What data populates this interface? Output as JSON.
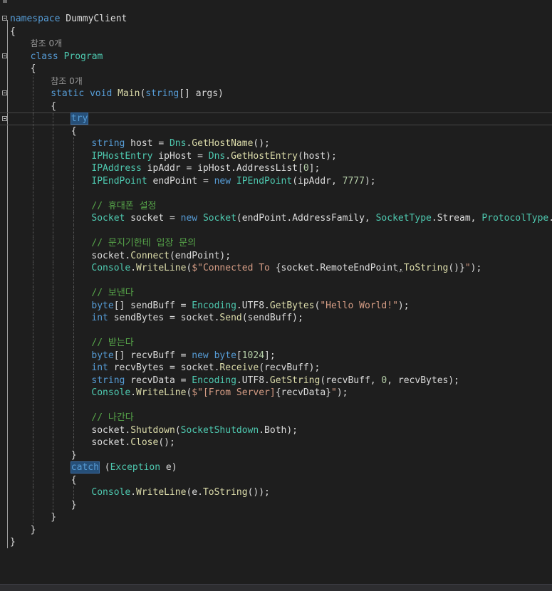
{
  "editor": {
    "language": "C#",
    "colors": {
      "background": "#1e1e1e",
      "keyword": "#569cd6",
      "type": "#4ec9b0",
      "method": "#dcdcaa",
      "string": "#d69d85",
      "comment": "#57a64a",
      "number": "#b5cea8",
      "text": "#dcdcdc"
    },
    "lines": [
      {
        "indent": 0,
        "fold": true,
        "tokens": [
          [
            "kw",
            "namespace"
          ],
          [
            "id",
            " DummyClient"
          ]
        ]
      },
      {
        "indent": 0,
        "tokens": [
          [
            "id",
            "{"
          ]
        ]
      },
      {
        "indent": 1,
        "tokens": [
          [
            "lens",
            "참조 0개"
          ]
        ]
      },
      {
        "indent": 1,
        "fold": true,
        "tokens": [
          [
            "kw",
            "class"
          ],
          [
            "id",
            " "
          ],
          [
            "ty",
            "Program"
          ]
        ]
      },
      {
        "indent": 1,
        "tokens": [
          [
            "id",
            "{"
          ]
        ]
      },
      {
        "indent": 2,
        "tokens": [
          [
            "lens",
            "참조 0개"
          ]
        ]
      },
      {
        "indent": 2,
        "fold": true,
        "tokens": [
          [
            "kw",
            "static"
          ],
          [
            "id",
            " "
          ],
          [
            "kw",
            "void"
          ],
          [
            "id",
            " "
          ],
          [
            "fn",
            "Main"
          ],
          [
            "id",
            "("
          ],
          [
            "kw",
            "string"
          ],
          [
            "id",
            "[] args)"
          ]
        ]
      },
      {
        "indent": 2,
        "tokens": [
          [
            "id",
            "{"
          ]
        ]
      },
      {
        "indent": 3,
        "fold": true,
        "current": true,
        "tokens": [
          [
            "kw hl",
            "try"
          ]
        ]
      },
      {
        "indent": 3,
        "tokens": [
          [
            "id",
            "{"
          ]
        ]
      },
      {
        "indent": 4,
        "tokens": [
          [
            "kw",
            "string"
          ],
          [
            "id",
            " host = "
          ],
          [
            "ty",
            "Dns"
          ],
          [
            "id",
            "."
          ],
          [
            "fn",
            "GetHostName"
          ],
          [
            "id",
            "();"
          ]
        ]
      },
      {
        "indent": 4,
        "tokens": [
          [
            "ty",
            "IPHostEntry"
          ],
          [
            "id",
            " ipHost = "
          ],
          [
            "ty",
            "Dns"
          ],
          [
            "id",
            "."
          ],
          [
            "fn",
            "GetHostEntry"
          ],
          [
            "id",
            "(host);"
          ]
        ]
      },
      {
        "indent": 4,
        "tokens": [
          [
            "ty",
            "IPAddress"
          ],
          [
            "id",
            " ipAddr = ipHost.AddressList["
          ],
          [
            "num",
            "0"
          ],
          [
            "id",
            "];"
          ]
        ]
      },
      {
        "indent": 4,
        "tokens": [
          [
            "ty",
            "IPEndPoint"
          ],
          [
            "id",
            " endPoint = "
          ],
          [
            "kw",
            "new"
          ],
          [
            "id",
            " "
          ],
          [
            "ty",
            "IPEndPoint"
          ],
          [
            "id",
            "(ipAddr, "
          ],
          [
            "num",
            "7777"
          ],
          [
            "id",
            ");"
          ]
        ]
      },
      {
        "indent": 4,
        "tokens": []
      },
      {
        "indent": 4,
        "tokens": [
          [
            "cm",
            "// 휴대폰 설정"
          ]
        ]
      },
      {
        "indent": 4,
        "tokens": [
          [
            "ty",
            "Socket"
          ],
          [
            "id",
            " socket = "
          ],
          [
            "kw",
            "new"
          ],
          [
            "id",
            " "
          ],
          [
            "ty",
            "Socket"
          ],
          [
            "id",
            "(endPoint.AddressFamily, "
          ],
          [
            "ty",
            "SocketType"
          ],
          [
            "id",
            ".Stream, "
          ],
          [
            "ty",
            "ProtocolType"
          ],
          [
            "id",
            ".Tcp);"
          ]
        ]
      },
      {
        "indent": 4,
        "tokens": []
      },
      {
        "indent": 4,
        "tokens": [
          [
            "cm",
            "// 문지기한테 입장 문의"
          ]
        ]
      },
      {
        "indent": 4,
        "tokens": [
          [
            "id",
            "socket."
          ],
          [
            "fn",
            "Connect"
          ],
          [
            "id",
            "(endPoint);"
          ]
        ]
      },
      {
        "indent": 4,
        "tokens": [
          [
            "ty",
            "Console"
          ],
          [
            "id",
            "."
          ],
          [
            "fn",
            "WriteLine"
          ],
          [
            "id",
            "("
          ],
          [
            "str",
            "$\"Connected To "
          ],
          [
            "id",
            "{socket.RemoteEndPoint"
          ],
          [
            "id sq",
            "."
          ],
          [
            "fn",
            "ToString"
          ],
          [
            "id",
            "()}"
          ],
          [
            "str",
            "\""
          ],
          [
            "id",
            ");"
          ]
        ]
      },
      {
        "indent": 4,
        "tokens": []
      },
      {
        "indent": 4,
        "tokens": [
          [
            "cm",
            "// 보낸다"
          ]
        ]
      },
      {
        "indent": 4,
        "tokens": [
          [
            "kw",
            "byte"
          ],
          [
            "id",
            "[] sendBuff = "
          ],
          [
            "ty",
            "Encoding"
          ],
          [
            "id",
            ".UTF8."
          ],
          [
            "fn",
            "GetBytes"
          ],
          [
            "id",
            "("
          ],
          [
            "str",
            "\"Hello World!\""
          ],
          [
            "id",
            ");"
          ]
        ]
      },
      {
        "indent": 4,
        "tokens": [
          [
            "kw",
            "int"
          ],
          [
            "id",
            " sendBytes = socket."
          ],
          [
            "fn",
            "Send"
          ],
          [
            "id",
            "(sendBuff);"
          ]
        ]
      },
      {
        "indent": 4,
        "tokens": []
      },
      {
        "indent": 4,
        "tokens": [
          [
            "cm",
            "// 받는다"
          ]
        ]
      },
      {
        "indent": 4,
        "tokens": [
          [
            "kw",
            "byte"
          ],
          [
            "id",
            "[] recvBuff = "
          ],
          [
            "kw",
            "new"
          ],
          [
            "id",
            " "
          ],
          [
            "kw",
            "byte"
          ],
          [
            "id",
            "["
          ],
          [
            "num",
            "1024"
          ],
          [
            "id",
            "];"
          ]
        ]
      },
      {
        "indent": 4,
        "tokens": [
          [
            "kw",
            "int"
          ],
          [
            "id",
            " recvBytes = socket."
          ],
          [
            "fn",
            "Receive"
          ],
          [
            "id",
            "(recvBuff);"
          ]
        ]
      },
      {
        "indent": 4,
        "tokens": [
          [
            "kw",
            "string"
          ],
          [
            "id",
            " recvData = "
          ],
          [
            "ty",
            "Encoding"
          ],
          [
            "id",
            ".UTF8."
          ],
          [
            "fn",
            "GetString"
          ],
          [
            "id",
            "(recvBuff, "
          ],
          [
            "num",
            "0"
          ],
          [
            "id",
            ", recvBytes);"
          ]
        ]
      },
      {
        "indent": 4,
        "tokens": [
          [
            "ty",
            "Console"
          ],
          [
            "id",
            "."
          ],
          [
            "fn",
            "WriteLine"
          ],
          [
            "id",
            "("
          ],
          [
            "str",
            "$\"[From Server]"
          ],
          [
            "id",
            "{recvData}"
          ],
          [
            "str",
            "\""
          ],
          [
            "id",
            ");"
          ]
        ]
      },
      {
        "indent": 4,
        "tokens": []
      },
      {
        "indent": 4,
        "tokens": [
          [
            "cm",
            "// 나간다"
          ]
        ]
      },
      {
        "indent": 4,
        "tokens": [
          [
            "id",
            "socket."
          ],
          [
            "fn",
            "Shutdown"
          ],
          [
            "id",
            "("
          ],
          [
            "ty",
            "SocketShutdown"
          ],
          [
            "id",
            ".Both);"
          ]
        ]
      },
      {
        "indent": 4,
        "tokens": [
          [
            "id",
            "socket."
          ],
          [
            "fn",
            "Close"
          ],
          [
            "id",
            "();"
          ]
        ]
      },
      {
        "indent": 3,
        "tokens": [
          [
            "id",
            "}"
          ]
        ]
      },
      {
        "indent": 3,
        "tokens": [
          [
            "kw hl",
            "catch"
          ],
          [
            "id",
            " ("
          ],
          [
            "ty",
            "Exception"
          ],
          [
            "id",
            " e)"
          ]
        ]
      },
      {
        "indent": 3,
        "tokens": [
          [
            "id",
            "{"
          ]
        ]
      },
      {
        "indent": 4,
        "tokens": [
          [
            "ty",
            "Console"
          ],
          [
            "id",
            "."
          ],
          [
            "fn",
            "WriteLine"
          ],
          [
            "id",
            "(e."
          ],
          [
            "fn",
            "ToString"
          ],
          [
            "id",
            "());"
          ]
        ]
      },
      {
        "indent": 3,
        "tokens": [
          [
            "id",
            "}"
          ]
        ]
      },
      {
        "indent": 2,
        "tokens": [
          [
            "id",
            "}"
          ]
        ]
      },
      {
        "indent": 1,
        "tokens": [
          [
            "id",
            "}"
          ]
        ]
      },
      {
        "indent": 0,
        "tokens": [
          [
            "id",
            "}"
          ]
        ]
      }
    ]
  }
}
